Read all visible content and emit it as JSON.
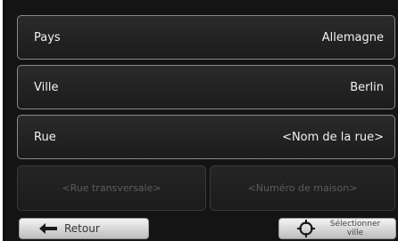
{
  "form": {
    "country": {
      "label": "Pays",
      "value": "Allemagne"
    },
    "city": {
      "label": "Ville",
      "value": "Berlin"
    },
    "street": {
      "label": "Rue",
      "value": "<Nom de la rue>"
    },
    "cross_street": {
      "placeholder": "<Rue transversale>",
      "enabled": false
    },
    "house_number": {
      "placeholder": "<Numéro de maison>",
      "enabled": false
    }
  },
  "footer": {
    "back_label": "Retour",
    "select_city_label": "Sélectionner ville",
    "back_icon": "left-arrow-icon",
    "select_icon": "crosshair-target-icon"
  },
  "colors": {
    "background": "#141414",
    "row_border": "#8a8a8a",
    "text": "#f2f2f2",
    "disabled_text": "#5d5d5d",
    "button_face": "#d8d8d8"
  }
}
